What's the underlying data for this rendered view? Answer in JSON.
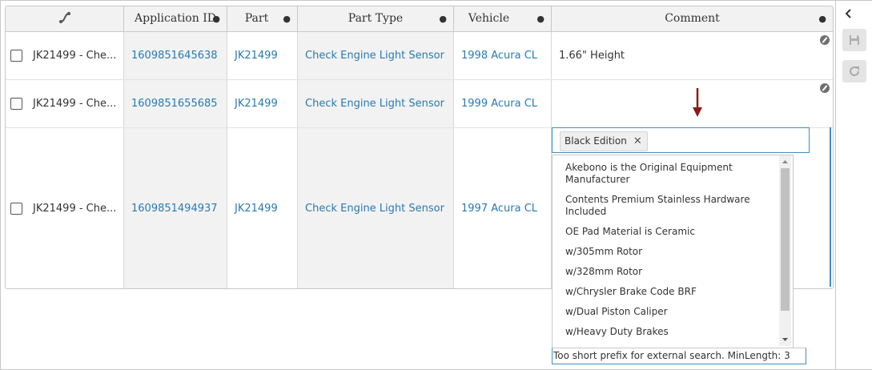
{
  "header": {
    "columns": [
      "Application ID",
      "Part",
      "Part Type",
      "Vehicle",
      "Comment"
    ]
  },
  "rows": [
    {
      "name": "JK21499 - Che...",
      "app_id": "1609851645638",
      "part": "JK21499",
      "part_type": "Check Engine Light Sensor",
      "vehicle": "1998 Acura CL",
      "comment": "1.66\" Height"
    },
    {
      "name": "JK21499 - Che...",
      "app_id": "1609851655685",
      "part": "JK21499",
      "part_type": "Check Engine Light Sensor",
      "vehicle": "1999 Acura CL",
      "comment": ""
    },
    {
      "name": "JK21499 - Che...",
      "app_id": "1609851494937",
      "part": "JK21499",
      "part_type": "Check Engine Light Sensor",
      "vehicle": "1997 Acura CL",
      "comment": ""
    }
  ],
  "editor": {
    "tag": "Black Edition",
    "tag_remove": "✕"
  },
  "dropdown": {
    "options": [
      "Akebono is the Original Equipment Manufacturer",
      "Contents Premium Stainless Hardware Included",
      "OE Pad Material is Ceramic",
      "w/305mm Rotor",
      "w/328mm Rotor",
      "w/Chrysler Brake Code BRF",
      "w/Dual Piston Caliper",
      "w/Heavy Duty Brakes"
    ],
    "footer": "Too short prefix for external search. MinLength: 3"
  },
  "colors": {
    "link": "#2a7ab0",
    "focus": "#3f8fc4",
    "arrow": "#8b1a1a"
  },
  "icons": {
    "header_first": "phone-link-icon",
    "collapse": "chevron-left-icon",
    "save": "save-icon",
    "refresh": "refresh-icon",
    "edit": "edit-icon"
  }
}
